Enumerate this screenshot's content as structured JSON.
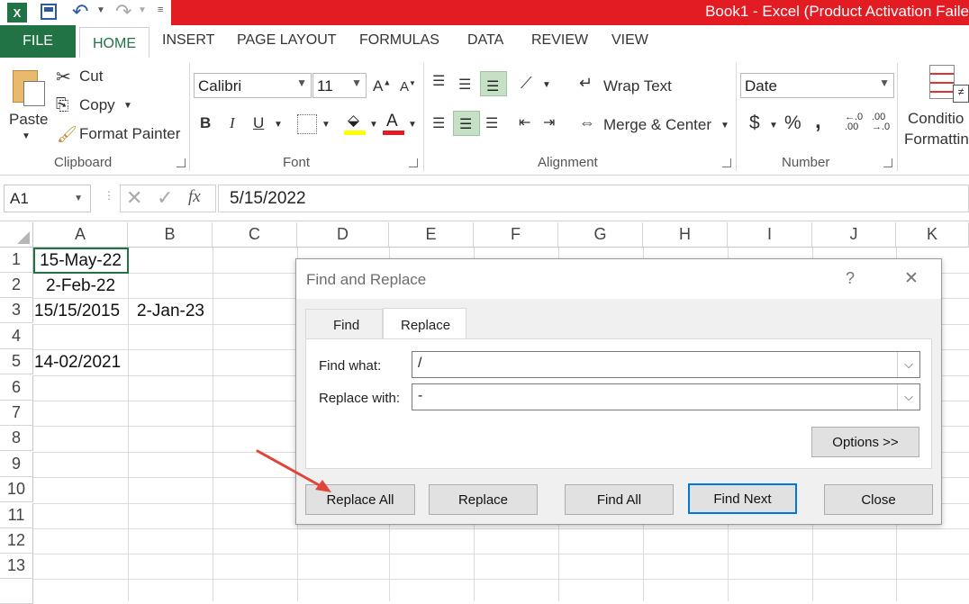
{
  "window": {
    "title": "Book1 - Excel (Product Activation Faile"
  },
  "ribbon_tabs": [
    "FILE",
    "HOME",
    "INSERT",
    "PAGE LAYOUT",
    "FORMULAS",
    "DATA",
    "REVIEW",
    "VIEW"
  ],
  "clipboard": {
    "paste": "Paste",
    "cut": "Cut",
    "copy": "Copy",
    "format_painter": "Format Painter",
    "label": "Clipboard"
  },
  "font": {
    "name": "Calibri",
    "size": "11",
    "label": "Font",
    "bold": "B",
    "italic": "I",
    "underline": "U"
  },
  "alignment": {
    "wrap_text": "Wrap Text",
    "merge_center": "Merge & Center",
    "label": "Alignment"
  },
  "number": {
    "format": "Date",
    "currency": "$",
    "percent": "%",
    "comma": ",",
    "label": "Number"
  },
  "styles": {
    "conditional_line1": "Conditio",
    "conditional_line2": "Formattin"
  },
  "formula_bar": {
    "name_box": "A1",
    "fx": "fx",
    "value": "5/15/2022"
  },
  "columns": [
    "A",
    "B",
    "C",
    "D",
    "E",
    "F",
    "G",
    "H",
    "I",
    "J",
    "K"
  ],
  "rows": [
    "1",
    "2",
    "3",
    "4",
    "5",
    "6",
    "7",
    "8",
    "9",
    "10",
    "11",
    "12",
    "13"
  ],
  "cells": {
    "A1": "15-May-22",
    "A2": "2-Feb-22",
    "A3": "15/15/2015",
    "B3": "2-Jan-23",
    "A5": "14-02/2021"
  },
  "dialog": {
    "title": "Find and Replace",
    "help": "?",
    "close": "✕",
    "tab_find": "Find",
    "tab_replace": "Replace",
    "find_label": "Find what:",
    "find_value": "/",
    "replace_label": "Replace with:",
    "replace_value": "-",
    "options_button": "Options >>",
    "replace_all_button": "Replace All",
    "replace_button": "Replace",
    "find_all_button": "Find All",
    "find_next_button": "Find Next",
    "close_button": "Close"
  },
  "colors": {
    "excel_green": "#217346",
    "title_red": "#e31b23",
    "annotation_arrow": "#e0443a"
  }
}
